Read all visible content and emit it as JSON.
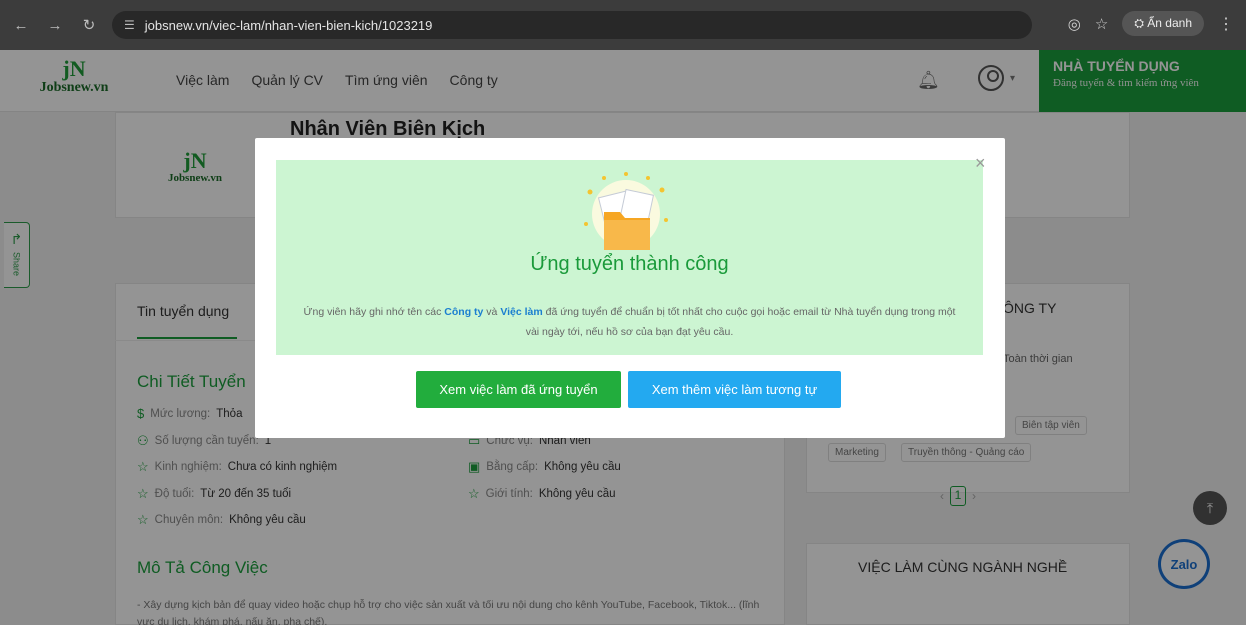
{
  "browser": {
    "back_icon": "arrow-left-icon",
    "forward_icon": "arrow-right-icon",
    "reload_icon": "reload-icon",
    "url": "jobsnew.vn/viec-lam/nhan-vien-bien-kich/1023219",
    "incognito_label": "Ẩn danh"
  },
  "site": {
    "logo_mark": "jN",
    "logo_text": "Jobsnew.vn",
    "nav": [
      "Việc làm",
      "Quản lý CV",
      "Tìm ứng viên",
      "Công ty"
    ],
    "employer_title": "NHÀ TUYỂN DỤNG",
    "employer_subtitle": "Đăng tuyển & tìm kiếm ứng viên"
  },
  "job": {
    "title": "Nhân Viên Biên Kịch",
    "share_label": "Share"
  },
  "left_panel": {
    "tab": "Tin tuyển dụng",
    "section_detail": "Chi Tiết Tuyển",
    "rows": [
      {
        "label": "Mức lương:",
        "value": "Thỏa"
      },
      {
        "label": "Số lượng cần tuyển:",
        "value": "1"
      },
      {
        "label": "Chức vụ:",
        "value": "Nhân viên"
      },
      {
        "label": "Kinh nghiệm:",
        "value": "Chưa có kinh nghiệm"
      },
      {
        "label": "Bằng cấp:",
        "value": "Không yêu cầu"
      },
      {
        "label": "Độ tuổi:",
        "value": "Từ 20 đến 35 tuổi"
      },
      {
        "label": "Giới tính:",
        "value": "Không yêu cầu"
      },
      {
        "label": "Chuyên môn:",
        "value": "Không yêu cầu"
      }
    ],
    "section_description": "Mô Tả Công Việc",
    "description": "- Xây dựng kịch bản để quay video hoặc chụp hỗ trợ cho việc sản xuất và tối ưu nội dung cho kênh YouTube, Facebook, Tiktok... (lĩnh vực du lịch, khám phá, nấu ăn, pha chế)."
  },
  "right_panel": {
    "heading": "ÔNG TY",
    "job_type": "Toàn thời gian",
    "tags": [
      "Biên tập viên",
      "Marketing",
      "Truyền thông - Quảng cáo"
    ],
    "page": "1",
    "prev": "‹",
    "next": "›",
    "related_heading": "VIỆC LÀM CÙNG NGÀNH NGHỀ"
  },
  "widgets": {
    "zalo_label": "Zalo",
    "scroll_top_icon": "arrow-up-icon"
  },
  "modal": {
    "close": "×",
    "title": "Ứng tuyển thành công",
    "msg_pre": "Ứng viên hãy ghi nhớ tên các ",
    "msg_company": "Công ty",
    "msg_and": " và ",
    "msg_job": "Việc làm",
    "msg_post": " đã ứng tuyển để chuẩn bị tốt nhất cho cuộc gọi hoặc email từ Nhà tuyển dụng trong một vài ngày tới, nếu hồ sơ của bạn đạt yêu cầu.",
    "btn_applied": "Xem việc làm đã ứng tuyển",
    "btn_similar": "Xem thêm việc làm tương tự"
  }
}
